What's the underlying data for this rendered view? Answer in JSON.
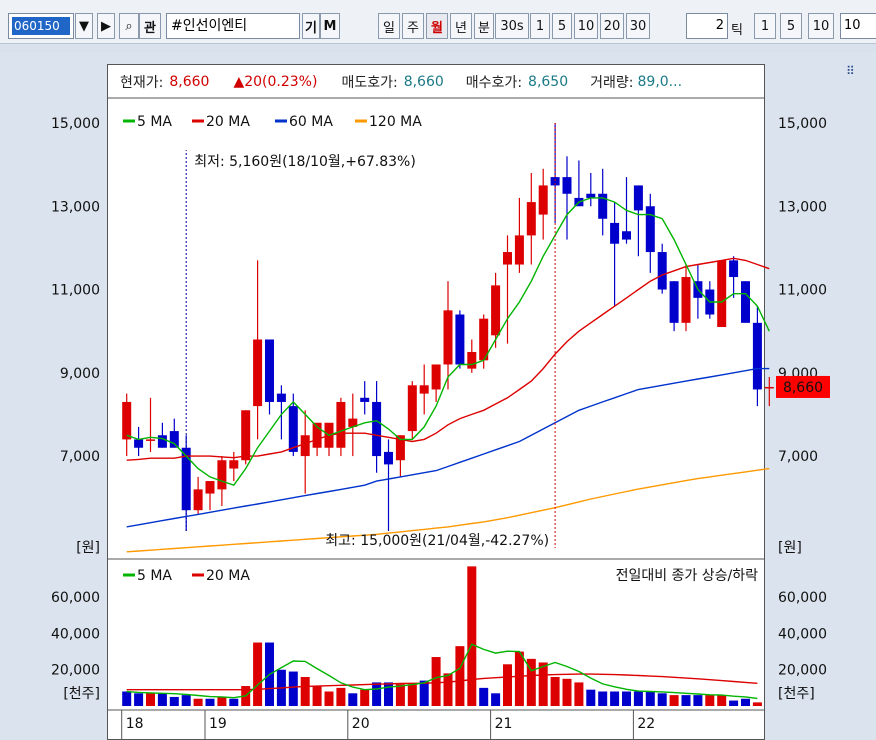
{
  "toolbar": {
    "code": "060150",
    "search_icon": "magnifier-icon",
    "gwan": "관",
    "name": "#인선이엔티",
    "gi": "기",
    "m": "M",
    "periods": [
      "일",
      "주",
      "월",
      "년",
      "분",
      "30s",
      "1",
      "5",
      "10",
      "20",
      "30"
    ],
    "active_period": "월",
    "count_value": "2",
    "tick_label": "틱",
    "tick_buttons": [
      "1",
      "5",
      "10"
    ],
    "right_input": "10"
  },
  "info": {
    "current_label": "현재가:",
    "current_value": "8,660",
    "change_value": "20(0.23%)",
    "ask_label": "매도호가:",
    "ask_value": "8,660",
    "bid_label": "매수호가:",
    "bid_value": "8,650",
    "volume_label": "거래량:",
    "volume_value": "89,0..."
  },
  "colors": {
    "up": "#dd0000",
    "down": "#0000cc",
    "ma5": "#00b400",
    "ma20": "#dd0000",
    "ma60": "#0033cc",
    "ma120": "#ff9900"
  },
  "chart_data": [
    {
      "type": "candlestick",
      "title": "",
      "legend": [
        "5 MA",
        "20 MA",
        "60 MA",
        "120 MA"
      ],
      "unit_label": "[원]",
      "yticks": [
        "15,000",
        "13,000",
        "11,000",
        "9,000",
        "7,000"
      ],
      "ytick_values": [
        15000,
        13000,
        11000,
        9000,
        7000
      ],
      "ylim": [
        4600,
        15600
      ],
      "current_price_tag": "8,660",
      "annotation_low": "최저: 5,160원(18/10월,+67.83%)",
      "annotation_high": "최고: 15,000원(21/04월,-42.27%)",
      "candles": [
        {
          "o": 7400,
          "h": 8500,
          "l": 7000,
          "c": 8300
        },
        {
          "o": 7400,
          "h": 7700,
          "l": 7000,
          "c": 7200
        },
        {
          "o": 7400,
          "h": 8400,
          "l": 7100,
          "c": 7400
        },
        {
          "o": 7500,
          "h": 7800,
          "l": 7200,
          "c": 7200
        },
        {
          "o": 7600,
          "h": 7900,
          "l": 7300,
          "c": 7200
        },
        {
          "o": 7200,
          "h": 7500,
          "l": 5200,
          "c": 5700
        },
        {
          "o": 5700,
          "h": 6500,
          "l": 5600,
          "c": 6200
        },
        {
          "o": 6100,
          "h": 6300,
          "l": 5700,
          "c": 6400
        },
        {
          "o": 6200,
          "h": 7000,
          "l": 5800,
          "c": 6900
        },
        {
          "o": 6700,
          "h": 7100,
          "l": 6400,
          "c": 6900
        },
        {
          "o": 6900,
          "h": 8100,
          "l": 6800,
          "c": 8100
        },
        {
          "o": 8200,
          "h": 11700,
          "l": 7400,
          "c": 9800
        },
        {
          "o": 9800,
          "h": 9800,
          "l": 8000,
          "c": 8300
        },
        {
          "o": 8500,
          "h": 8700,
          "l": 7400,
          "c": 8300
        },
        {
          "o": 8200,
          "h": 8500,
          "l": 7000,
          "c": 7100
        },
        {
          "o": 7000,
          "h": 8100,
          "l": 6100,
          "c": 7500
        },
        {
          "o": 7200,
          "h": 7700,
          "l": 7000,
          "c": 7800
        },
        {
          "o": 7200,
          "h": 7600,
          "l": 7000,
          "c": 7800
        },
        {
          "o": 7200,
          "h": 8400,
          "l": 7000,
          "c": 8300
        },
        {
          "o": 7700,
          "h": 8500,
          "l": 7000,
          "c": 7900
        },
        {
          "o": 8400,
          "h": 8800,
          "l": 8000,
          "c": 8300
        },
        {
          "o": 8300,
          "h": 8800,
          "l": 6600,
          "c": 7000
        },
        {
          "o": 7100,
          "h": 7400,
          "l": 5200,
          "c": 6800
        },
        {
          "o": 6900,
          "h": 7500,
          "l": 6500,
          "c": 7500
        },
        {
          "o": 7600,
          "h": 8800,
          "l": 7400,
          "c": 8700
        },
        {
          "o": 8500,
          "h": 9200,
          "l": 8000,
          "c": 8700
        },
        {
          "o": 8600,
          "h": 9100,
          "l": 8300,
          "c": 9200
        },
        {
          "o": 9200,
          "h": 11200,
          "l": 8600,
          "c": 10500
        },
        {
          "o": 10400,
          "h": 10500,
          "l": 9100,
          "c": 9200
        },
        {
          "o": 9100,
          "h": 9800,
          "l": 9000,
          "c": 9500
        },
        {
          "o": 9300,
          "h": 10400,
          "l": 9100,
          "c": 10300
        },
        {
          "o": 9900,
          "h": 11400,
          "l": 9600,
          "c": 11100
        },
        {
          "o": 11600,
          "h": 12300,
          "l": 9700,
          "c": 11900
        },
        {
          "o": 11600,
          "h": 13200,
          "l": 11400,
          "c": 12300
        },
        {
          "o": 12300,
          "h": 13800,
          "l": 11600,
          "c": 13100
        },
        {
          "o": 12800,
          "h": 13900,
          "l": 12200,
          "c": 13500
        },
        {
          "o": 13700,
          "h": 15000,
          "l": 12600,
          "c": 13500
        },
        {
          "o": 13700,
          "h": 14200,
          "l": 12200,
          "c": 13300
        },
        {
          "o": 13200,
          "h": 14100,
          "l": 13100,
          "c": 13000
        },
        {
          "o": 13300,
          "h": 13800,
          "l": 13000,
          "c": 13200
        },
        {
          "o": 13300,
          "h": 13900,
          "l": 12300,
          "c": 12700
        },
        {
          "o": 12600,
          "h": 13100,
          "l": 10600,
          "c": 12100
        },
        {
          "o": 12400,
          "h": 13700,
          "l": 12100,
          "c": 12200
        },
        {
          "o": 13500,
          "h": 13500,
          "l": 11800,
          "c": 12900
        },
        {
          "o": 13000,
          "h": 13300,
          "l": 11400,
          "c": 11900
        },
        {
          "o": 11900,
          "h": 12100,
          "l": 10900,
          "c": 11000
        },
        {
          "o": 11200,
          "h": 11200,
          "l": 10000,
          "c": 10200
        },
        {
          "o": 10200,
          "h": 11600,
          "l": 10000,
          "c": 11300
        },
        {
          "o": 11200,
          "h": 11600,
          "l": 10300,
          "c": 10800
        },
        {
          "o": 11000,
          "h": 11200,
          "l": 10300,
          "c": 10400
        },
        {
          "o": 10100,
          "h": 11700,
          "l": 10100,
          "c": 11700
        },
        {
          "o": 11700,
          "h": 11800,
          "l": 10800,
          "c": 11300
        },
        {
          "o": 11200,
          "h": 11200,
          "l": 10200,
          "c": 10200
        },
        {
          "o": 10200,
          "h": 10600,
          "l": 8200,
          "c": 8600
        },
        {
          "o": 8640,
          "h": 8900,
          "l": 8200,
          "c": 8660
        }
      ],
      "ma5": [
        7500,
        7400,
        7450,
        7420,
        7300,
        7000,
        6700,
        6500,
        6400,
        6300,
        6700,
        7200,
        7600,
        8000,
        8300,
        8000,
        7700,
        7500,
        7600,
        7700,
        7800,
        7850,
        7650,
        7400,
        7400,
        7700,
        8200,
        8900,
        9200,
        9200,
        9300,
        9800,
        10300,
        10700,
        11200,
        11800,
        12300,
        12800,
        13100,
        13200,
        13200,
        13100,
        12900,
        12800,
        12800,
        12700,
        12200,
        11600,
        11000,
        10700,
        10700,
        10900,
        10900,
        10600,
        10000
      ],
      "ma20": [
        6900,
        6920,
        6950,
        6950,
        6950,
        7000,
        7000,
        7000,
        6980,
        6960,
        7000,
        7000,
        7050,
        7100,
        7200,
        7300,
        7400,
        7500,
        7550,
        7550,
        7550,
        7500,
        7450,
        7400,
        7350,
        7400,
        7550,
        7750,
        7900,
        8000,
        8100,
        8250,
        8400,
        8600,
        8800,
        9100,
        9450,
        9750,
        10000,
        10200,
        10400,
        10600,
        10800,
        11000,
        11200,
        11350,
        11450,
        11550,
        11600,
        11650,
        11700,
        11750,
        11700,
        11600,
        11500
      ],
      "ma60": [
        5300,
        5350,
        5400,
        5450,
        5500,
        5550,
        5600,
        5650,
        5700,
        5750,
        5800,
        5850,
        5900,
        5950,
        6000,
        6050,
        6100,
        6150,
        6200,
        6250,
        6300,
        6400,
        6450,
        6500,
        6550,
        6600,
        6650,
        6750,
        6850,
        6950,
        7050,
        7150,
        7250,
        7350,
        7500,
        7650,
        7800,
        7950,
        8100,
        8200,
        8300,
        8400,
        8500,
        8600,
        8650,
        8700,
        8750,
        8800,
        8850,
        8900,
        8950,
        9000,
        9050,
        9100,
        9100
      ],
      "ma120": [
        4700,
        4720,
        4740,
        4760,
        4780,
        4800,
        4820,
        4840,
        4860,
        4880,
        4900,
        4920,
        4940,
        4960,
        4980,
        5000,
        5020,
        5040,
        5060,
        5080,
        5100,
        5120,
        5150,
        5180,
        5210,
        5240,
        5270,
        5300,
        5340,
        5380,
        5420,
        5470,
        5520,
        5580,
        5640,
        5700,
        5760,
        5830,
        5900,
        5970,
        6030,
        6090,
        6150,
        6210,
        6260,
        6310,
        6360,
        6410,
        6460,
        6500,
        6540,
        6580,
        6620,
        6660,
        6700
      ]
    },
    {
      "type": "bar",
      "title": "",
      "legend": [
        "5 MA",
        "20 MA"
      ],
      "right_note": "전일대비 종가 상승/하락",
      "unit_label": "[천주]",
      "yticks": [
        "60,000",
        "40,000",
        "20,000"
      ],
      "ytick_values": [
        60000,
        40000,
        20000
      ],
      "ylim": [
        0,
        75000
      ],
      "volumes": [
        {
          "v": 8000,
          "up": false
        },
        {
          "v": 7000,
          "up": false
        },
        {
          "v": 7000,
          "up": true
        },
        {
          "v": 7000,
          "up": false
        },
        {
          "v": 5000,
          "up": false
        },
        {
          "v": 6000,
          "up": false
        },
        {
          "v": 4000,
          "up": true
        },
        {
          "v": 4000,
          "up": false
        },
        {
          "v": 5000,
          "up": true
        },
        {
          "v": 4000,
          "up": false
        },
        {
          "v": 11000,
          "up": true
        },
        {
          "v": 35000,
          "up": true
        },
        {
          "v": 35000,
          "up": false
        },
        {
          "v": 20000,
          "up": false
        },
        {
          "v": 19000,
          "up": false
        },
        {
          "v": 16000,
          "up": true
        },
        {
          "v": 11000,
          "up": true
        },
        {
          "v": 8000,
          "up": true
        },
        {
          "v": 10000,
          "up": true
        },
        {
          "v": 7000,
          "up": false
        },
        {
          "v": 9000,
          "up": true
        },
        {
          "v": 13000,
          "up": false
        },
        {
          "v": 13000,
          "up": false
        },
        {
          "v": 12000,
          "up": true
        },
        {
          "v": 12000,
          "up": true
        },
        {
          "v": 14000,
          "up": false
        },
        {
          "v": 27000,
          "up": true
        },
        {
          "v": 18000,
          "up": true
        },
        {
          "v": 33000,
          "up": true
        },
        {
          "v": 78000,
          "up": true
        },
        {
          "v": 10000,
          "up": false
        },
        {
          "v": 7000,
          "up": false
        },
        {
          "v": 23000,
          "up": true
        },
        {
          "v": 30000,
          "up": true
        },
        {
          "v": 26000,
          "up": true
        },
        {
          "v": 24000,
          "up": true
        },
        {
          "v": 16000,
          "up": true
        },
        {
          "v": 15000,
          "up": true
        },
        {
          "v": 13000,
          "up": true
        },
        {
          "v": 9000,
          "up": false
        },
        {
          "v": 8000,
          "up": false
        },
        {
          "v": 8000,
          "up": false
        },
        {
          "v": 8000,
          "up": false
        },
        {
          "v": 8000,
          "up": false
        },
        {
          "v": 8000,
          "up": false
        },
        {
          "v": 7000,
          "up": false
        },
        {
          "v": 6000,
          "up": true
        },
        {
          "v": 6000,
          "up": false
        },
        {
          "v": 6000,
          "up": false
        },
        {
          "v": 6000,
          "up": true
        },
        {
          "v": 6000,
          "up": true
        },
        {
          "v": 3000,
          "up": false
        },
        {
          "v": 4000,
          "up": false
        },
        {
          "v": 2000,
          "up": true
        }
      ],
      "vma5": [
        8000,
        7500,
        7200,
        7000,
        6800,
        6400,
        5800,
        5200,
        5000,
        4600,
        5600,
        11600,
        17400,
        21200,
        24800,
        24600,
        20600,
        16800,
        12800,
        10400,
        9000,
        9400,
        10400,
        11000,
        11800,
        12800,
        15600,
        16800,
        20800,
        34000,
        31200,
        29200,
        30200,
        30000,
        19400,
        21800,
        24000,
        21800,
        19000,
        15400,
        12200,
        10600,
        9200,
        8200,
        8000,
        7800,
        7400,
        7000,
        6600,
        6200,
        6000,
        5400,
        5000,
        4200
      ],
      "vma20": [
        9000,
        9000,
        9000,
        9000,
        9000,
        9000,
        9000,
        9000,
        9000,
        9000,
        9000,
        9200,
        9600,
        10000,
        10400,
        10800,
        11000,
        11200,
        11400,
        11600,
        11800,
        12000,
        12200,
        12400,
        12500,
        12600,
        12800,
        13200,
        13800,
        14600,
        15200,
        15600,
        16000,
        16400,
        16800,
        17100,
        17300,
        17500,
        17600,
        17600,
        17500,
        17300,
        17100,
        16800,
        16500,
        16200,
        15800,
        15400,
        15000,
        14500,
        14000,
        13500,
        13000,
        12500
      ]
    },
    {
      "type": "axis",
      "xlabels": [
        "18",
        "19",
        "20",
        "21",
        "22"
      ],
      "xlabel_index": [
        0,
        7,
        19,
        31,
        43
      ]
    }
  ]
}
